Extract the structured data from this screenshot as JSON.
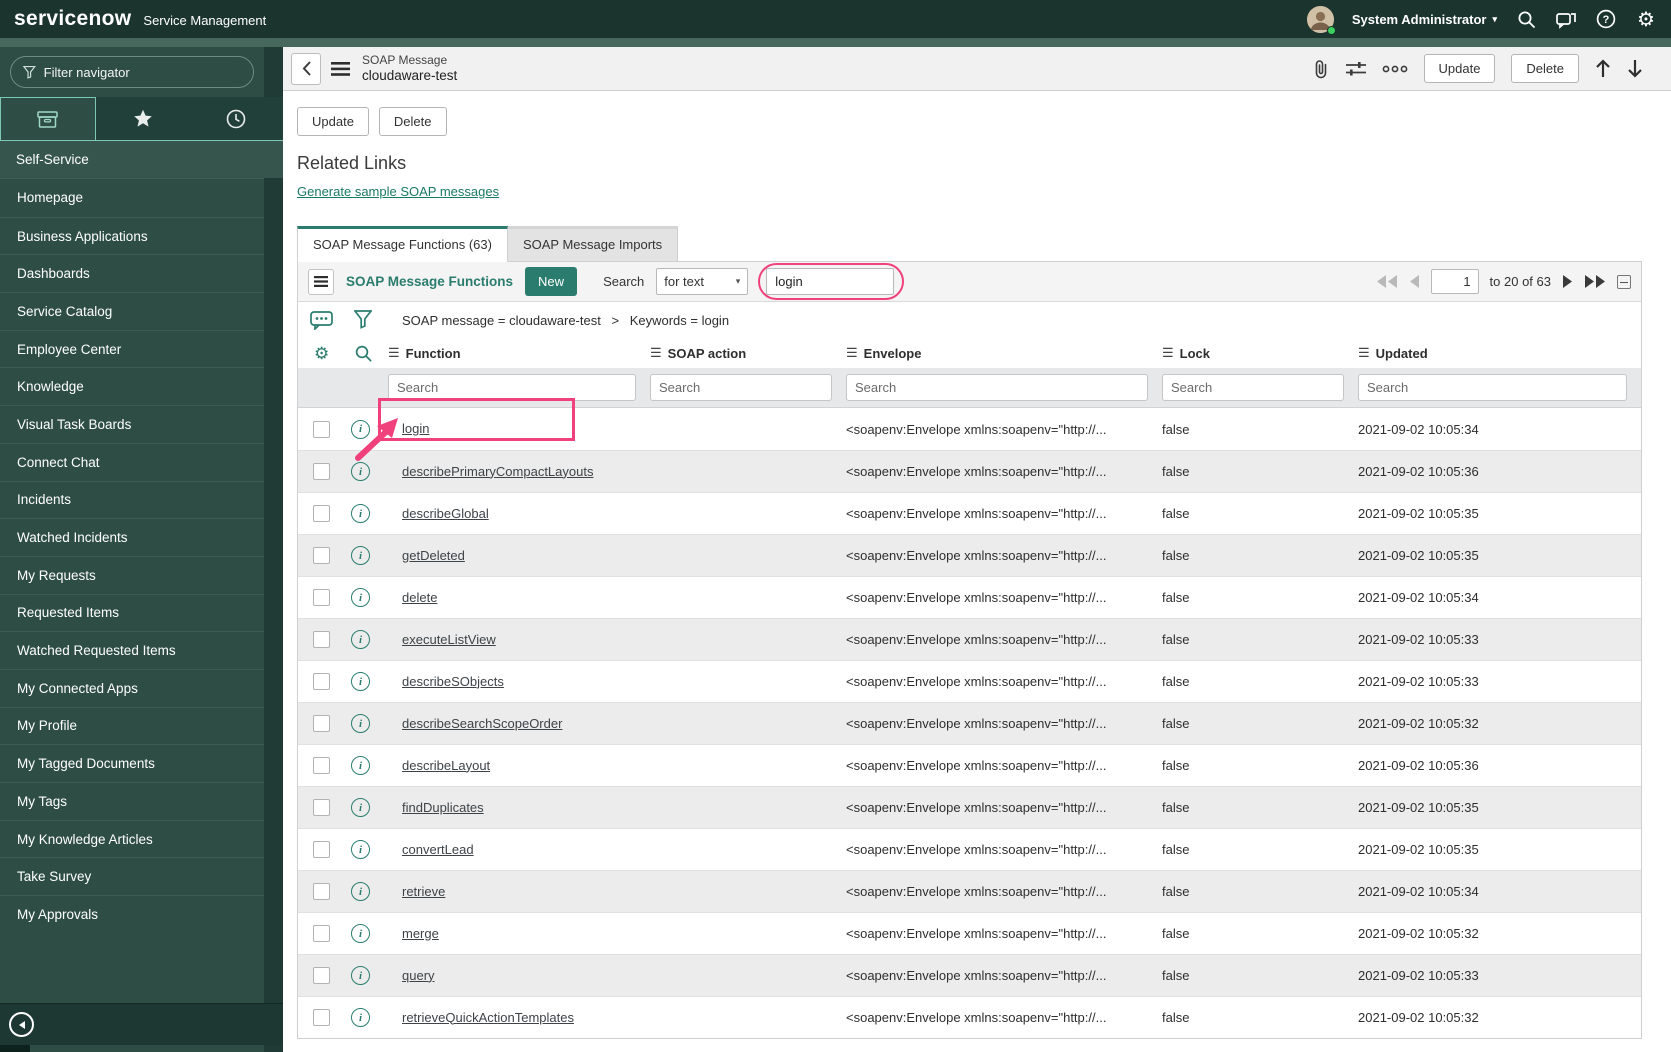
{
  "topbar": {
    "brand": "servicenow",
    "product": "Service Management",
    "user": "System Administrator"
  },
  "sidebar": {
    "filter_placeholder": "Filter navigator",
    "section": "Self-Service",
    "items": [
      "Homepage",
      "Business Applications",
      "Dashboards",
      "Service Catalog",
      "Employee Center",
      "Knowledge",
      "Visual Task Boards",
      "Connect Chat",
      "Incidents",
      "Watched Incidents",
      "My Requests",
      "Requested Items",
      "Watched Requested Items",
      "My Connected Apps",
      "My Profile",
      "My Tagged Documents",
      "My Tags",
      "My Knowledge Articles",
      "Take Survey",
      "My Approvals"
    ]
  },
  "form_header": {
    "record_type": "SOAP Message",
    "record_name": "cloudaware-test",
    "update_label": "Update",
    "delete_label": "Delete"
  },
  "related_links": {
    "heading": "Related Links",
    "link_label": "Generate sample SOAP messages"
  },
  "tabs": [
    {
      "label": "SOAP Message Functions (63)",
      "active": true
    },
    {
      "label": "SOAP Message Imports",
      "active": false
    }
  ],
  "list": {
    "title": "SOAP Message Functions",
    "new_label": "New",
    "search_label": "Search",
    "search_mode": "for text",
    "search_value": "login",
    "breadcrumb_part1": "SOAP message = cloudaware-test",
    "breadcrumb_separator": ">",
    "breadcrumb_part2": "Keywords = login",
    "pagination": {
      "page": "1",
      "range_label": "to 20 of 63"
    },
    "columns": [
      "Function",
      "SOAP action",
      "Envelope",
      "Lock",
      "Updated"
    ],
    "column_search_placeholder": "Search",
    "rows": [
      {
        "function": "login",
        "soap_action": "",
        "envelope": "<soapenv:Envelope xmlns:soapenv=\"http://...",
        "lock": "false",
        "updated": "2021-09-02 10:05:34",
        "annotated": true
      },
      {
        "function": "describePrimaryCompactLayouts",
        "soap_action": "",
        "envelope": "<soapenv:Envelope xmlns:soapenv=\"http://...",
        "lock": "false",
        "updated": "2021-09-02 10:05:36"
      },
      {
        "function": "describeGlobal",
        "soap_action": "",
        "envelope": "<soapenv:Envelope xmlns:soapenv=\"http://...",
        "lock": "false",
        "updated": "2021-09-02 10:05:35"
      },
      {
        "function": "getDeleted",
        "soap_action": "",
        "envelope": "<soapenv:Envelope xmlns:soapenv=\"http://...",
        "lock": "false",
        "updated": "2021-09-02 10:05:35"
      },
      {
        "function": "delete",
        "soap_action": "",
        "envelope": "<soapenv:Envelope xmlns:soapenv=\"http://...",
        "lock": "false",
        "updated": "2021-09-02 10:05:34"
      },
      {
        "function": "executeListView",
        "soap_action": "",
        "envelope": "<soapenv:Envelope xmlns:soapenv=\"http://...",
        "lock": "false",
        "updated": "2021-09-02 10:05:33"
      },
      {
        "function": "describeSObjects",
        "soap_action": "",
        "envelope": "<soapenv:Envelope xmlns:soapenv=\"http://...",
        "lock": "false",
        "updated": "2021-09-02 10:05:33"
      },
      {
        "function": "describeSearchScopeOrder",
        "soap_action": "",
        "envelope": "<soapenv:Envelope xmlns:soapenv=\"http://...",
        "lock": "false",
        "updated": "2021-09-02 10:05:32"
      },
      {
        "function": "describeLayout",
        "soap_action": "",
        "envelope": "<soapenv:Envelope xmlns:soapenv=\"http://...",
        "lock": "false",
        "updated": "2021-09-02 10:05:36"
      },
      {
        "function": "findDuplicates",
        "soap_action": "",
        "envelope": "<soapenv:Envelope xmlns:soapenv=\"http://...",
        "lock": "false",
        "updated": "2021-09-02 10:05:35"
      },
      {
        "function": "convertLead",
        "soap_action": "",
        "envelope": "<soapenv:Envelope xmlns:soapenv=\"http://...",
        "lock": "false",
        "updated": "2021-09-02 10:05:35"
      },
      {
        "function": "retrieve",
        "soap_action": "",
        "envelope": "<soapenv:Envelope xmlns:soapenv=\"http://...",
        "lock": "false",
        "updated": "2021-09-02 10:05:34"
      },
      {
        "function": "merge",
        "soap_action": "",
        "envelope": "<soapenv:Envelope xmlns:soapenv=\"http://...",
        "lock": "false",
        "updated": "2021-09-02 10:05:32"
      },
      {
        "function": "query",
        "soap_action": "",
        "envelope": "<soapenv:Envelope xmlns:soapenv=\"http://...",
        "lock": "false",
        "updated": "2021-09-02 10:05:33"
      },
      {
        "function": "retrieveQuickActionTemplates",
        "soap_action": "",
        "envelope": "<soapenv:Envelope xmlns:soapenv=\"http://...",
        "lock": "false",
        "updated": "2021-09-02 10:05:32"
      }
    ]
  },
  "annotation_color": "#f0417c"
}
